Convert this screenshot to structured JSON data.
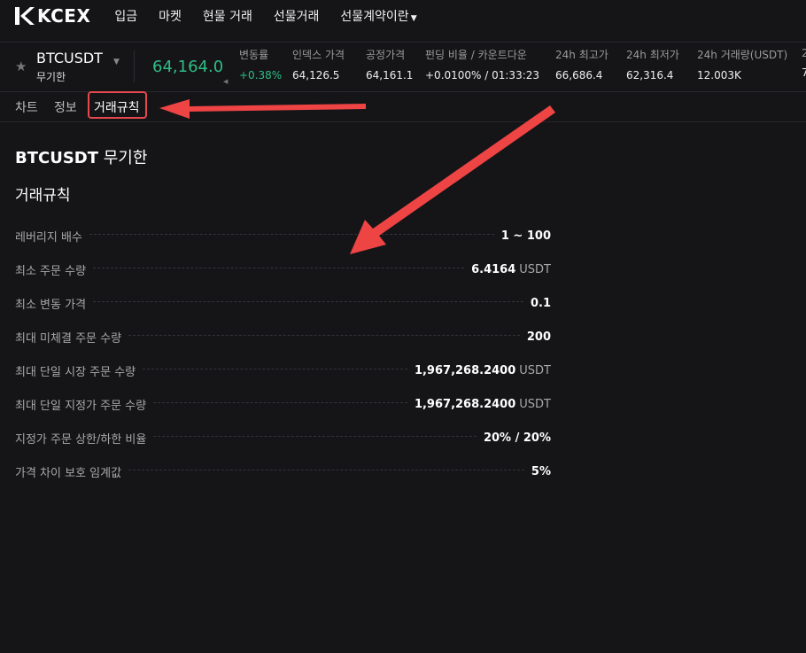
{
  "nav": {
    "logo_text": "KCEX",
    "items": [
      "입금",
      "마켓",
      "현물 거래",
      "선물거래",
      "선물계약이란"
    ]
  },
  "ticker": {
    "symbol": "BTCUSDT",
    "contract_type": "무기한",
    "last_price": "64,164.0",
    "stats": [
      {
        "label": "변동률",
        "value": "+0.38%"
      },
      {
        "label": "인덱스 가격",
        "value": "64,126.5"
      },
      {
        "label": "공정가격",
        "value": "64,161.1"
      },
      {
        "label": "펀딩 비율 / 카운트다운",
        "value": "+0.0100% / 01:33:23"
      },
      {
        "label": "24h 최고가",
        "value": "66,686.4"
      },
      {
        "label": "24h 최저가",
        "value": "62,316.4"
      },
      {
        "label": "24h 거래량(USDT)",
        "value": "12.003K"
      },
      {
        "label": "2",
        "value": "7"
      }
    ]
  },
  "tabs": [
    "차트",
    "정보",
    "거래규칙"
  ],
  "content": {
    "symbol": "BTCUSDT",
    "contract_type": "무기한",
    "section_title": "거래규칙",
    "rules": [
      {
        "label": "레버리지 배수",
        "value": "1 ~ 100",
        "unit": ""
      },
      {
        "label": "최소 주문 수량",
        "value": "6.4164",
        "unit": "USDT"
      },
      {
        "label": "최소 변동 가격",
        "value": "0.1",
        "unit": ""
      },
      {
        "label": "최대 미체결 주문 수량",
        "value": "200",
        "unit": ""
      },
      {
        "label": "최대 단일 시장 주문 수량",
        "value": "1,967,268.2400",
        "unit": "USDT"
      },
      {
        "label": "최대 단일 지정가 주문 수량",
        "value": "1,967,268.2400",
        "unit": "USDT"
      },
      {
        "label": "지정가 주문 상한/하한 비율",
        "value": "20% / 20%",
        "unit": ""
      },
      {
        "label": "가격 차이 보호 임계값",
        "value": "5%",
        "unit": ""
      }
    ]
  },
  "colors": {
    "accent_green": "#2ebd85",
    "annotation_red": "#e5484d",
    "background": "#151518"
  }
}
